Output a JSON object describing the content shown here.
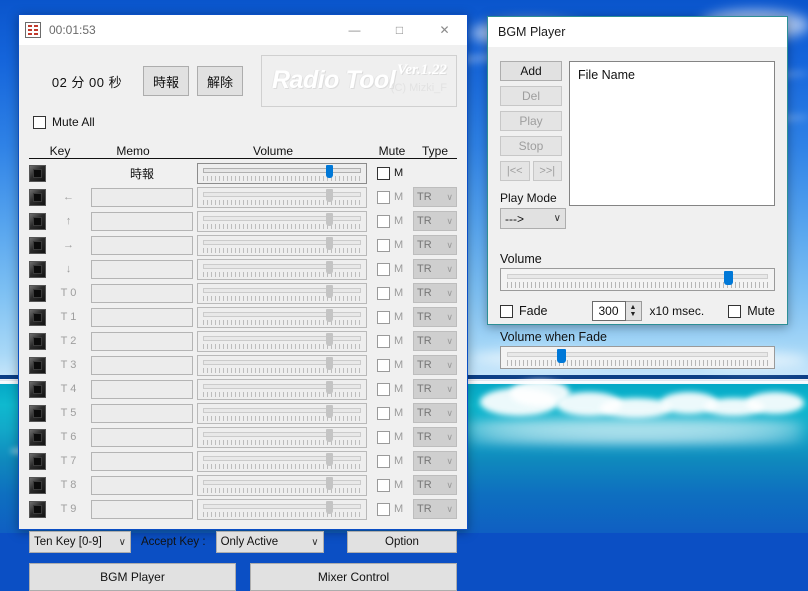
{
  "desktop": {
    "wallpaper_name": "tropical-ocean-wallpaper"
  },
  "radio_tool": {
    "titlebar": {
      "icon": "radio-tool-icon",
      "title": "00:01:53",
      "minimize": "—",
      "maximize": "□",
      "close": "✕"
    },
    "timer_display": "02 分 00 秒",
    "buttons": {
      "jihou": "時報",
      "kaijo": "解除"
    },
    "logo": {
      "name": "Radio Tool",
      "version": "Ver.1.22",
      "copyright": "(C) Mizki_F"
    },
    "mute_all": {
      "label": "Mute All",
      "checked": false
    },
    "columns": {
      "key": "Key",
      "memo": "Memo",
      "volume": "Volume",
      "mute": "Mute",
      "type": "Type"
    },
    "rows": [
      {
        "key": "",
        "memo_label": "時報",
        "has_memo_input": false,
        "memo": "",
        "volume": 78,
        "slider_enabled": true,
        "mute_label": "M",
        "mute_checked": false,
        "mute_enabled": true,
        "type": "",
        "type_enabled": false,
        "has_type": false
      },
      {
        "key": "←",
        "memo_label": "",
        "has_memo_input": true,
        "memo": "",
        "volume": 78,
        "slider_enabled": false,
        "mute_label": "M",
        "mute_checked": false,
        "mute_enabled": false,
        "type": "TR",
        "type_enabled": false,
        "has_type": true
      },
      {
        "key": "↑",
        "memo_label": "",
        "has_memo_input": true,
        "memo": "",
        "volume": 78,
        "slider_enabled": false,
        "mute_label": "M",
        "mute_checked": false,
        "mute_enabled": false,
        "type": "TR",
        "type_enabled": false,
        "has_type": true
      },
      {
        "key": "→",
        "memo_label": "",
        "has_memo_input": true,
        "memo": "",
        "volume": 78,
        "slider_enabled": false,
        "mute_label": "M",
        "mute_checked": false,
        "mute_enabled": false,
        "type": "TR",
        "type_enabled": false,
        "has_type": true
      },
      {
        "key": "↓",
        "memo_label": "",
        "has_memo_input": true,
        "memo": "",
        "volume": 78,
        "slider_enabled": false,
        "mute_label": "M",
        "mute_checked": false,
        "mute_enabled": false,
        "type": "TR",
        "type_enabled": false,
        "has_type": true
      },
      {
        "key": "T 0",
        "memo_label": "",
        "has_memo_input": true,
        "memo": "",
        "volume": 78,
        "slider_enabled": false,
        "mute_label": "M",
        "mute_checked": false,
        "mute_enabled": false,
        "type": "TR",
        "type_enabled": false,
        "has_type": true
      },
      {
        "key": "T 1",
        "memo_label": "",
        "has_memo_input": true,
        "memo": "",
        "volume": 78,
        "slider_enabled": false,
        "mute_label": "M",
        "mute_checked": false,
        "mute_enabled": false,
        "type": "TR",
        "type_enabled": false,
        "has_type": true
      },
      {
        "key": "T 2",
        "memo_label": "",
        "has_memo_input": true,
        "memo": "",
        "volume": 78,
        "slider_enabled": false,
        "mute_label": "M",
        "mute_checked": false,
        "mute_enabled": false,
        "type": "TR",
        "type_enabled": false,
        "has_type": true
      },
      {
        "key": "T 3",
        "memo_label": "",
        "has_memo_input": true,
        "memo": "",
        "volume": 78,
        "slider_enabled": false,
        "mute_label": "M",
        "mute_checked": false,
        "mute_enabled": false,
        "type": "TR",
        "type_enabled": false,
        "has_type": true
      },
      {
        "key": "T 4",
        "memo_label": "",
        "has_memo_input": true,
        "memo": "",
        "volume": 78,
        "slider_enabled": false,
        "mute_label": "M",
        "mute_checked": false,
        "mute_enabled": false,
        "type": "TR",
        "type_enabled": false,
        "has_type": true
      },
      {
        "key": "T 5",
        "memo_label": "",
        "has_memo_input": true,
        "memo": "",
        "volume": 78,
        "slider_enabled": false,
        "mute_label": "M",
        "mute_checked": false,
        "mute_enabled": false,
        "type": "TR",
        "type_enabled": false,
        "has_type": true
      },
      {
        "key": "T 6",
        "memo_label": "",
        "has_memo_input": true,
        "memo": "",
        "volume": 78,
        "slider_enabled": false,
        "mute_label": "M",
        "mute_checked": false,
        "mute_enabled": false,
        "type": "TR",
        "type_enabled": false,
        "has_type": true
      },
      {
        "key": "T 7",
        "memo_label": "",
        "has_memo_input": true,
        "memo": "",
        "volume": 78,
        "slider_enabled": false,
        "mute_label": "M",
        "mute_checked": false,
        "mute_enabled": false,
        "type": "TR",
        "type_enabled": false,
        "has_type": true
      },
      {
        "key": "T 8",
        "memo_label": "",
        "has_memo_input": true,
        "memo": "",
        "volume": 78,
        "slider_enabled": false,
        "mute_label": "M",
        "mute_checked": false,
        "mute_enabled": false,
        "type": "TR",
        "type_enabled": false,
        "has_type": true
      },
      {
        "key": "T 9",
        "memo_label": "",
        "has_memo_input": true,
        "memo": "",
        "volume": 78,
        "slider_enabled": false,
        "mute_label": "M",
        "mute_checked": false,
        "mute_enabled": false,
        "type": "TR",
        "type_enabled": false,
        "has_type": true
      }
    ],
    "footer": {
      "ten_key_value": "Ten Key [0-9]",
      "accept_key_label": "Accept Key :",
      "accept_key_value": "Only Active",
      "option_button": "Option",
      "bgm_player_button": "BGM Player",
      "mixer_control_button": "Mixer Control",
      "chevron": "∨"
    }
  },
  "bgm_player": {
    "title": "BGM Player",
    "buttons": {
      "add": "Add",
      "del": "Del",
      "play": "Play",
      "stop": "Stop",
      "prev": "|<<",
      "next": ">>|"
    },
    "play_mode": {
      "label": "Play Mode",
      "value": "--->",
      "chevron": "∨"
    },
    "file_list": {
      "header": "File Name",
      "items": []
    },
    "volume": {
      "label": "Volume",
      "value": 83
    },
    "fade": {
      "label": "Fade",
      "checked": false
    },
    "fade_time": {
      "value": "300",
      "unit": "x10 msec.",
      "up": "▲",
      "down": "▼"
    },
    "mute": {
      "label": "Mute",
      "checked": false
    },
    "volume_when_fade": {
      "label": "Volume when Fade",
      "value": 22
    }
  },
  "colors": {
    "accent": "#0078d7",
    "desktop_blue": "#0b4fc4",
    "window_bg": "#f0f0f0",
    "bgm_border": "#2d8f96"
  }
}
